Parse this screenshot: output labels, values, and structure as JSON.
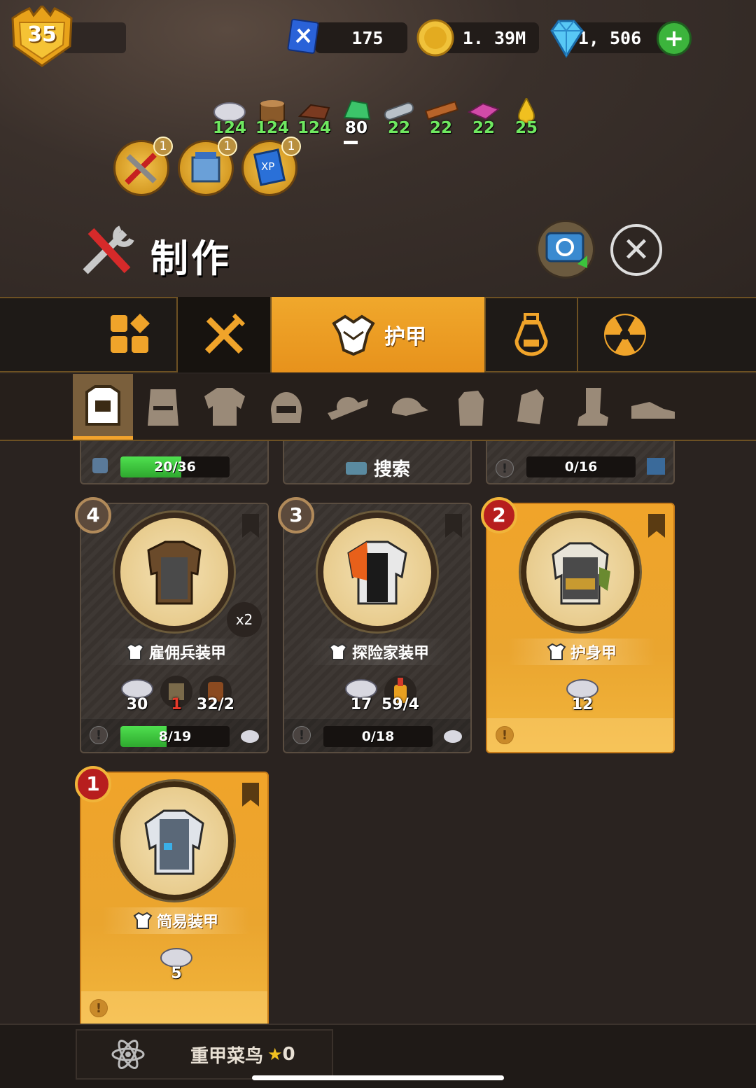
{
  "header": {
    "level": "35",
    "blueprints": "175",
    "coins": "1. 39M",
    "gems": "1, 506",
    "plus_label": "+"
  },
  "materials": [
    {
      "icon": "cloth-icon",
      "count": "124"
    },
    {
      "icon": "wood-log-icon",
      "count": "124"
    },
    {
      "icon": "leather-icon",
      "count": "124"
    },
    {
      "icon": "plastic-icon",
      "count": "80"
    },
    {
      "icon": "metal-pipe-icon",
      "count": "22"
    },
    {
      "icon": "plank-icon",
      "count": "22"
    },
    {
      "icon": "fabric-pink-icon",
      "count": "22"
    },
    {
      "icon": "fuel-drop-icon",
      "count": "25"
    }
  ],
  "quick_buttons": [
    {
      "icon": "craft-tools-icon",
      "badge": "1"
    },
    {
      "icon": "workbench-icon",
      "badge": "1"
    },
    {
      "icon": "xp-book-icon",
      "badge": "1"
    }
  ],
  "title": "制作",
  "close_label": "✕",
  "tabs": [
    {
      "name": "all",
      "label": ""
    },
    {
      "name": "weapons",
      "label": ""
    },
    {
      "name": "armor",
      "label": "护甲"
    },
    {
      "name": "consumables",
      "label": ""
    },
    {
      "name": "radiation",
      "label": ""
    }
  ],
  "partial_row": {
    "left_progress": "20/36",
    "left_fill": 0.556,
    "middle_label": "搜索",
    "right_progress": "0/16"
  },
  "cards": [
    {
      "rank": "4",
      "name": "雇佣兵装甲",
      "multiplier": "x2",
      "costs": [
        {
          "icon": "cloth-icon",
          "value": "30",
          "red": false
        },
        {
          "icon": "armor-part-icon",
          "value": "1",
          "red": true
        },
        {
          "icon": "leather-roll-icon",
          "value": "32/2",
          "red": false
        }
      ],
      "progress": "8/19",
      "fill": 0.421,
      "gold": false
    },
    {
      "rank": "3",
      "name": "探险家装甲",
      "multiplier": "",
      "costs": [
        {
          "icon": "cloth-icon",
          "value": "17",
          "red": false
        },
        {
          "icon": "glue-icon",
          "value": "59/4",
          "red": false
        }
      ],
      "progress": "0/18",
      "fill": 0,
      "gold": false
    },
    {
      "rank": "2",
      "name": "护身甲",
      "multiplier": "",
      "costs": [
        {
          "icon": "cloth-icon",
          "value": "12",
          "red": false
        }
      ],
      "progress": "",
      "fill": 0,
      "gold": true
    },
    {
      "rank": "1",
      "name": "简易装甲",
      "multiplier": "",
      "costs": [
        {
          "icon": "cloth-icon",
          "value": "5",
          "red": false
        }
      ],
      "progress": "",
      "fill": 0,
      "gold": true
    }
  ],
  "bottom": {
    "rank_title": "重甲菜鸟",
    "stars": "0",
    "star_glyph": "★"
  },
  "colors": {
    "accent": "#f0a42a",
    "progress": "#3cc43c",
    "badge_red": "#b71e1e"
  }
}
